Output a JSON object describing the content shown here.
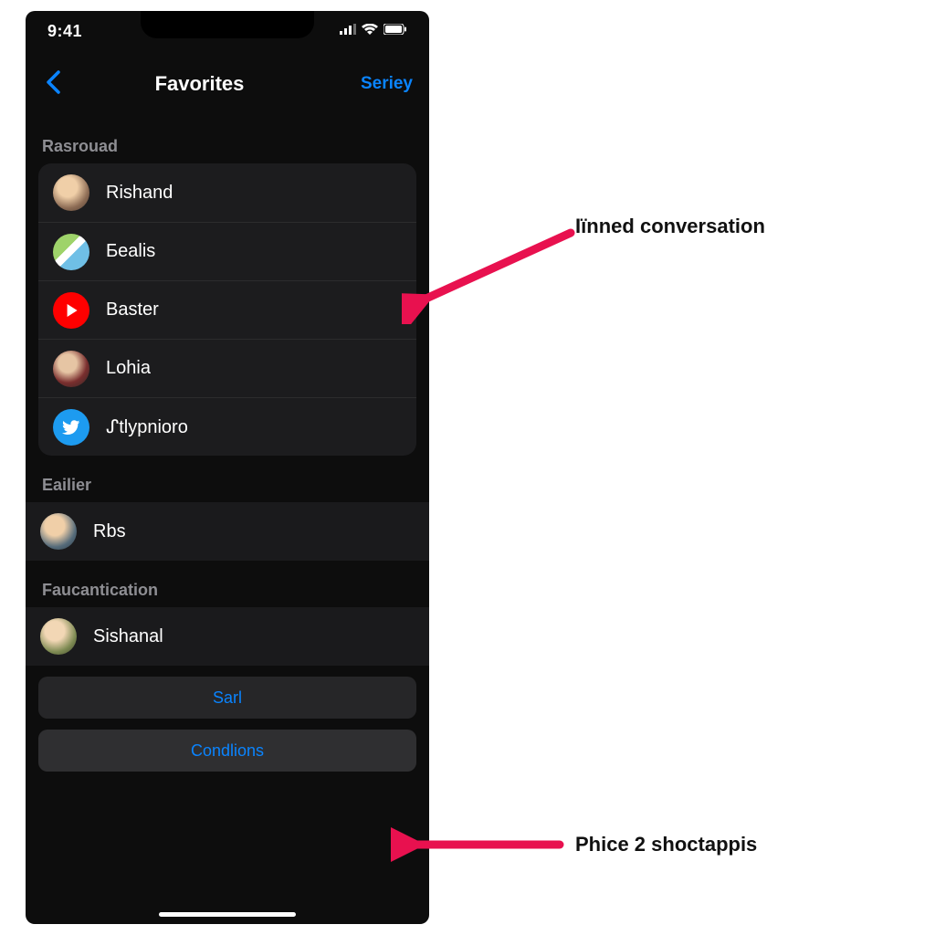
{
  "status": {
    "time": "9:41"
  },
  "nav": {
    "title": "Favorites",
    "action": "Seriey"
  },
  "sections": {
    "group0": {
      "header": "Rasrouad",
      "items": [
        {
          "label": "Rishand"
        },
        {
          "label": "Ƃealis"
        },
        {
          "label": "Baster"
        },
        {
          "label": "Lohia"
        },
        {
          "label": "ᔑtlypnioro"
        }
      ]
    },
    "group1": {
      "header": "Eailier",
      "items": [
        {
          "label": "Rbs"
        }
      ]
    },
    "group2": {
      "header": "Faucantication",
      "items": [
        {
          "label": "Sishanal"
        }
      ]
    }
  },
  "buttons": {
    "primary": "Sarl",
    "secondary": "Condlions"
  },
  "annotations": {
    "a1": "Iїnned conversation",
    "a2": "Phice 2 shoctappis"
  }
}
